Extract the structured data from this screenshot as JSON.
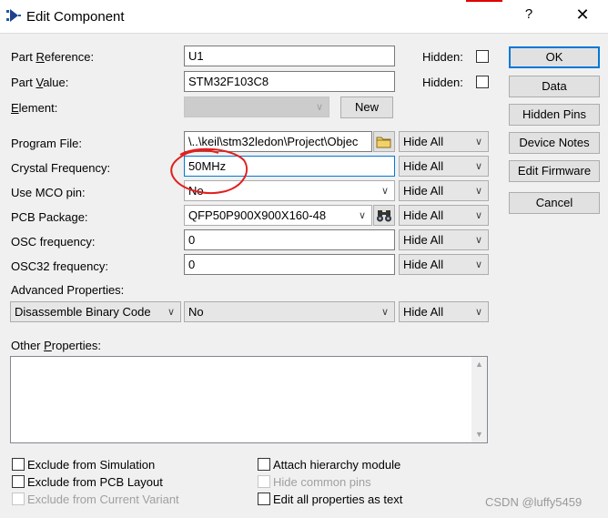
{
  "window": {
    "title": "Edit Component",
    "help_glyph": "?",
    "close_glyph": "✕"
  },
  "fields": {
    "part_reference": {
      "label_pre": "Part ",
      "label_u": "R",
      "label_post": "eference:",
      "value": "U1",
      "hidden_label": "Hidden:"
    },
    "part_value": {
      "label_pre": "Part ",
      "label_u": "V",
      "label_post": "alue:",
      "value": "STM32F103C8",
      "hidden_label": "Hidden:"
    },
    "element": {
      "label_u": "E",
      "label_post": "lement:",
      "value": "",
      "new_button": "New"
    },
    "program_file": {
      "label": "Program File:",
      "value": "\\..\\keil\\stm32ledon\\Project\\Objec",
      "visibility": "Hide All"
    },
    "crystal_frequency": {
      "label": "Crystal Frequency:",
      "value": "50MHz",
      "visibility": "Hide All"
    },
    "use_mco_pin": {
      "label": "Use MCO pin:",
      "value": "No",
      "visibility": "Hide All"
    },
    "pcb_package": {
      "label": "PCB Package:",
      "value": "QFP50P900X900X160-48",
      "visibility": "Hide All"
    },
    "osc_frequency": {
      "label": "OSC frequency:",
      "value": "0",
      "visibility": "Hide All"
    },
    "osc32_frequency": {
      "label": "OSC32 frequency:",
      "value": "0",
      "visibility": "Hide All"
    }
  },
  "advanced": {
    "label": "Advanced Properties:",
    "property": "Disassemble Binary Code",
    "value": "No",
    "visibility": "Hide All"
  },
  "other_properties": {
    "label_pre": "Other ",
    "label_u": "P",
    "label_post": "roperties:",
    "value": ""
  },
  "buttons": {
    "ok": "OK",
    "data": "Data",
    "hidden_pins": "Hidden Pins",
    "device_notes": "Device Notes",
    "edit_firmware": "Edit Firmware",
    "cancel": "Cancel"
  },
  "options": {
    "exclude_simulation": "Exclude from Simulation",
    "exclude_pcb": "Exclude from PCB Layout",
    "exclude_variant": "Exclude from Current Variant",
    "attach_hierarchy": "Attach hierarchy module",
    "hide_common_pins": "Hide common pins",
    "edit_all_text": "Edit all properties as text"
  },
  "watermark": "CSDN @luffy5459",
  "icons": {
    "app": "component-icon",
    "folder": "folder-icon",
    "binoculars": "binoculars-icon"
  },
  "colors": {
    "annotation": "#e0201e",
    "focus": "#0078d7"
  }
}
